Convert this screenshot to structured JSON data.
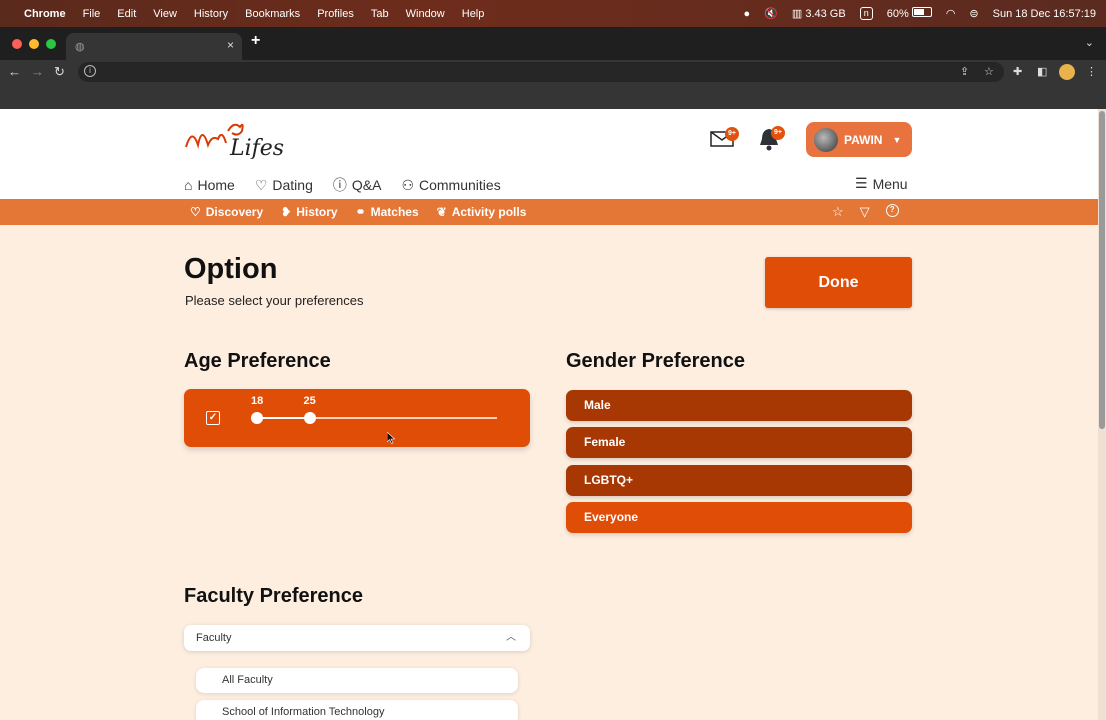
{
  "os_menubar": {
    "app_name": "Chrome",
    "menus": [
      "File",
      "Edit",
      "View",
      "History",
      "Bookmarks",
      "Profiles",
      "Tab",
      "Window",
      "Help"
    ],
    "memory": "3.43 GB",
    "input_source": "n",
    "battery": "60%",
    "datetime": "Sun 18 Dec  16:57:19"
  },
  "browser": {
    "tab_close": "×",
    "new_tab": "+"
  },
  "header": {
    "logo_text": "Lifes",
    "mail_badge": "9+",
    "bell_badge": "9+",
    "user_name": "PAWIN",
    "nav": [
      {
        "label": "Home",
        "icon": "home-icon"
      },
      {
        "label": "Dating",
        "icon": "heart-icon"
      },
      {
        "label": "Q&A",
        "icon": "question-icon"
      },
      {
        "label": "Communities",
        "icon": "people-icon"
      }
    ],
    "menu_label": "Menu"
  },
  "subnav": {
    "items": [
      {
        "label": "Discovery",
        "icon": "heart-outline-icon"
      },
      {
        "label": "History",
        "icon": "chat-heart-icon"
      },
      {
        "label": "Matches",
        "icon": "handshake-icon"
      },
      {
        "label": "Activity polls",
        "icon": "poll-icon"
      }
    ]
  },
  "page": {
    "title": "Option",
    "subtitle": "Please select your preferences",
    "done_label": "Done",
    "age": {
      "heading": "Age Preference",
      "enabled": true,
      "min_label": "18",
      "max_label": "25",
      "min_value": 18,
      "max_value": 25,
      "track_min": 18,
      "track_max": 50
    },
    "gender": {
      "heading": "Gender Preference",
      "options": [
        "Male",
        "Female",
        "LGBTQ+",
        "Everyone"
      ],
      "selected": "Everyone"
    },
    "faculty": {
      "heading": "Faculty Preference",
      "select_label": "Faculty",
      "options": [
        "All Faculty",
        "School of Information Technology"
      ]
    }
  },
  "colors": {
    "primary": "#e04d07",
    "unselected_option": "#a83803",
    "subnav": "#e47636",
    "page_bg": "#fdeee0"
  }
}
